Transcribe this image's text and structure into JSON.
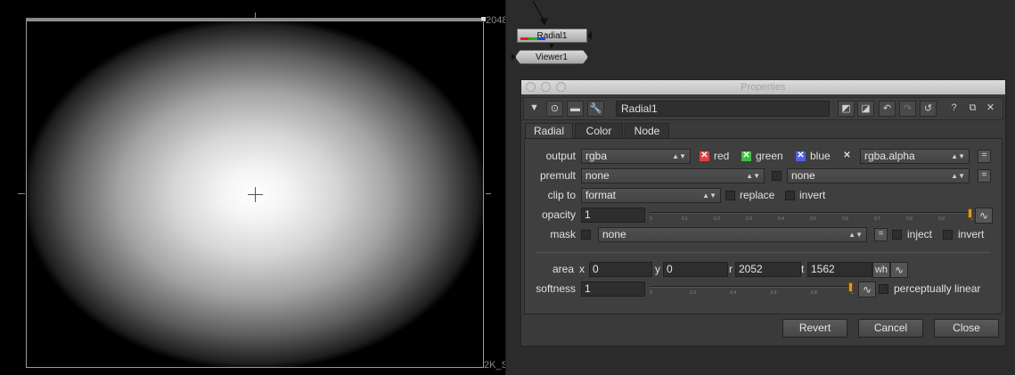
{
  "viewer": {
    "resolution_label": "2048",
    "format_label": "2K_S"
  },
  "node_graph": {
    "nodes": [
      {
        "name": "Radial1"
      },
      {
        "name": "Viewer1"
      }
    ],
    "channel_colors": [
      "#e02020",
      "#20b020",
      "#2040e0"
    ]
  },
  "properties": {
    "title": "Properties",
    "node_name": "Radial1",
    "toolbar_icons": [
      "collapse-icon",
      "center-icon",
      "camera-icon",
      "settings-icon",
      "color-swatch-icon",
      "color-swatch-icon",
      "undo-icon",
      "redo-icon",
      "revert-icon",
      "help-icon",
      "float-icon",
      "close-icon"
    ],
    "help_label": "?",
    "close_label": "✕",
    "tabs": [
      "Radial",
      "Color",
      "Node"
    ],
    "active_tab": "Radial",
    "output": {
      "label": "output",
      "value": "rgba",
      "red": "red",
      "green": "green",
      "blue": "blue",
      "alpha_value": "rgba.alpha",
      "eq": "="
    },
    "premult": {
      "label": "premult",
      "value": "none",
      "value2": "none",
      "eq": "="
    },
    "clip_to": {
      "label": "clip to",
      "value": "format",
      "replace": "replace",
      "invert": "invert"
    },
    "opacity": {
      "label": "opacity",
      "value": "1",
      "ticks": [
        "0",
        "0.1",
        "0.2",
        "0.3",
        "0.4",
        "0.5",
        "0.6",
        "0.7",
        "0.8",
        "0.9",
        "1"
      ],
      "level": 1
    },
    "mask": {
      "label": "mask",
      "value": "none",
      "eq": "=",
      "inject": "inject",
      "invert": "invert"
    },
    "area": {
      "label": "area",
      "x_label": "x",
      "x": "0",
      "y_label": "y",
      "y": "0",
      "r_label": "r",
      "r": "2052",
      "t_label": "t",
      "t": "1562",
      "wh": "wh"
    },
    "softness": {
      "label": "softness",
      "value": "1",
      "ticks": [
        "0",
        "0.2",
        "0.4",
        "0.6",
        "0.8",
        "1"
      ],
      "level": 1,
      "perceptual": "perceptually linear"
    },
    "buttons": {
      "revert": "Revert",
      "cancel": "Cancel",
      "close": "Close"
    }
  },
  "colors": {
    "red_check": "#e04040",
    "green_check": "#40c040",
    "blue_check": "#5060e0",
    "slider_handle": "#d79a32"
  }
}
